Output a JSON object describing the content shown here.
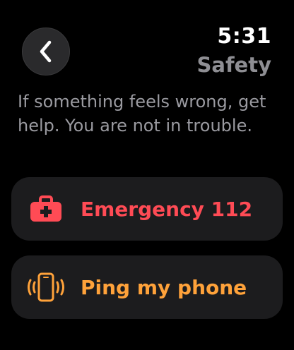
{
  "status": {
    "time": "5:31"
  },
  "header": {
    "title": "Safety"
  },
  "description": "If something feels wrong, get help. You are not in trouble.",
  "actions": [
    {
      "label": "Emergency 112",
      "icon": "first-aid-kit-icon",
      "color": "#ff4b55"
    },
    {
      "label": "Ping my phone",
      "icon": "ping-phone-icon",
      "color": "#ffa23a"
    }
  ],
  "colors": {
    "background": "#000000",
    "card": "#1c1c1e",
    "secondary_text": "#8e8e93"
  }
}
